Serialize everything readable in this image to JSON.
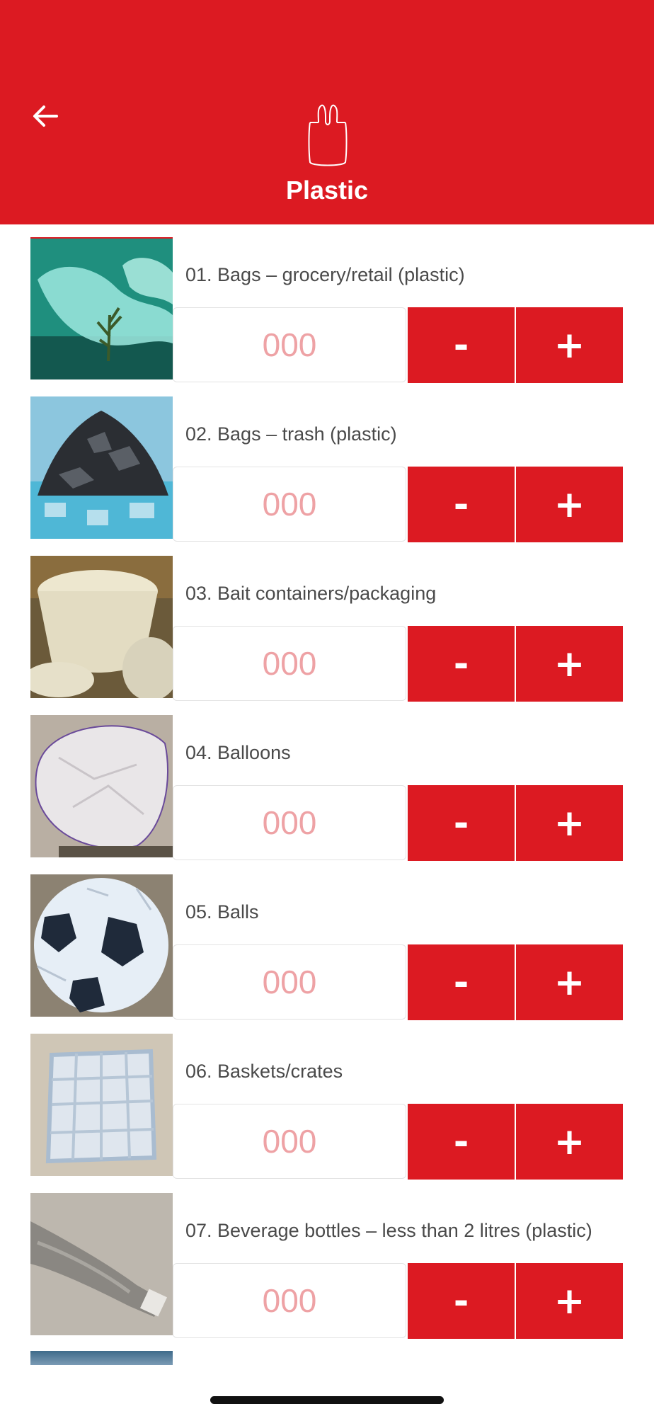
{
  "header": {
    "title": "Plastic",
    "back_icon": "arrow-left-icon",
    "category_icon": "plastic-bag-icon",
    "background_color": "#dc1a22"
  },
  "controls": {
    "minus_label": "-",
    "plus_label": "+",
    "count_placeholder": "000"
  },
  "items": [
    {
      "label": "01. Bags – grocery/retail (plastic)",
      "photo": "underwater-plastic-bag"
    },
    {
      "label": "02. Bags – trash (plastic)",
      "photo": "trash-bags-pile"
    },
    {
      "label": "03. Bait containers/packaging",
      "photo": "foam-bait-containers"
    },
    {
      "label": "04. Balloons",
      "photo": "deflated-balloon-on-sand"
    },
    {
      "label": "05. Balls",
      "photo": "worn-soccer-ball"
    },
    {
      "label": "06. Baskets/crates",
      "photo": "plastic-basket-on-sand"
    },
    {
      "label": "07. Beverage bottles – less than 2 litres (plastic)",
      "photo": "plastic-bottle-in-sand"
    }
  ]
}
